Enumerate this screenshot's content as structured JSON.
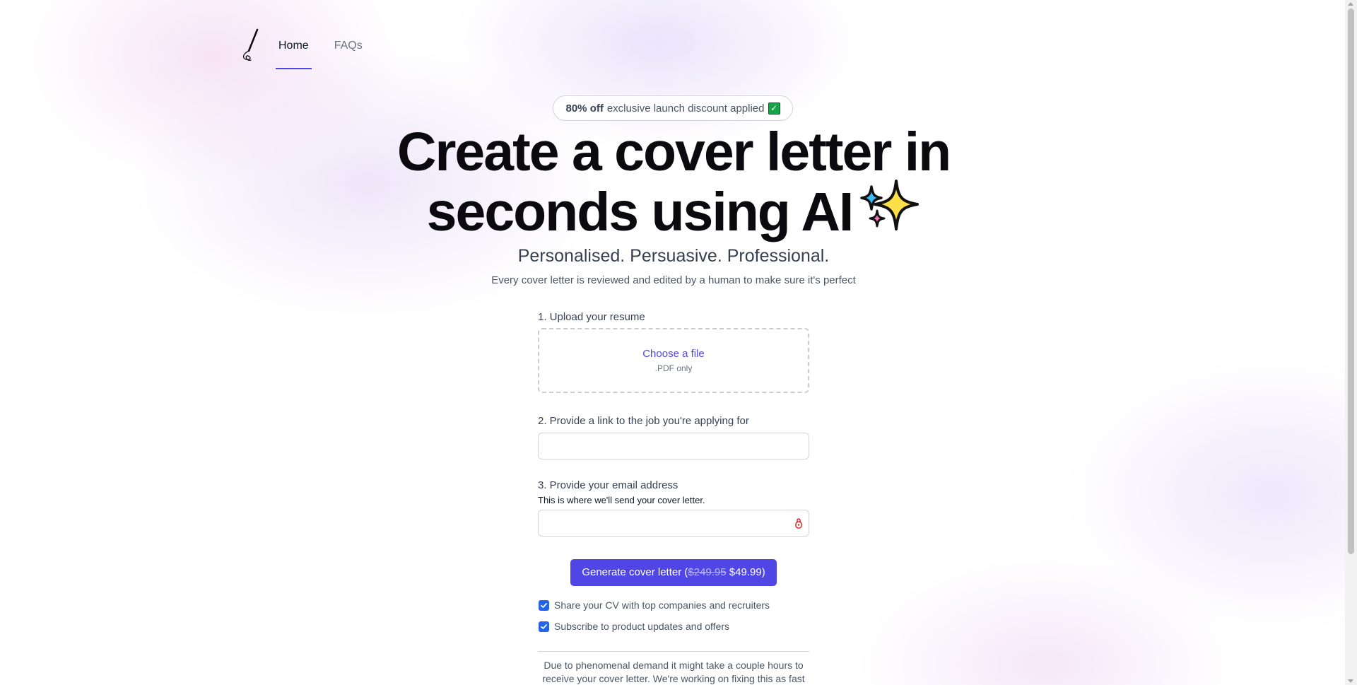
{
  "nav": {
    "logo_icon": "pen-icon",
    "links": [
      {
        "label": "Home",
        "active": true
      },
      {
        "label": "FAQs",
        "active": false
      }
    ],
    "accent_color": "#4f46e5"
  },
  "hero": {
    "badge": {
      "bold": "80% off",
      "text": "exclusive launch discount applied",
      "icon": "check-mark-icon"
    },
    "title_line1": "Create a cover letter in",
    "title_line2": "seconds using AI",
    "title_icon": "sparkles-icon",
    "subtitle": "Personalised. Persuasive. Professional.",
    "tagline": "Every cover letter is reviewed and edited by a human to make sure it's perfect"
  },
  "form": {
    "step1": {
      "label": "1. Upload your resume",
      "choose_file": "Choose a file",
      "hint": ".PDF only"
    },
    "step2": {
      "label": "2. Provide a link to the job you're applying for",
      "value": "",
      "placeholder": ""
    },
    "step3": {
      "label": "3. Provide your email address",
      "help": "This is where we'll send your cover letter.",
      "value": "",
      "placeholder": "",
      "icon": "password-manager-icon"
    },
    "submit": {
      "prefix": "Generate cover letter (",
      "old_price": "$249.95",
      "new_price": "$49.99",
      "suffix": ")",
      "color": "#4f46e5"
    },
    "options": [
      {
        "label": "Share your CV with top companies and recruiters",
        "checked": true
      },
      {
        "label": "Subscribe to product updates and offers",
        "checked": true
      }
    ],
    "notice": "Due to phenomenal demand it might take a couple hours to receive your cover letter. We're working on fixing this as fast as possible."
  }
}
